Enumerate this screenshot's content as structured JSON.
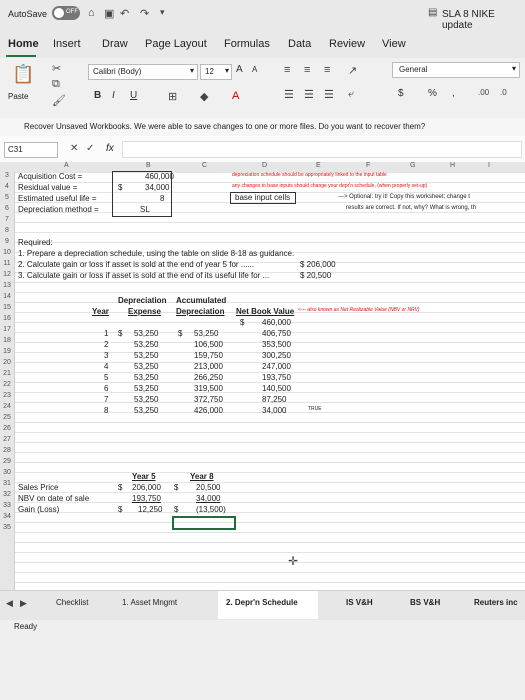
{
  "titlebar": {
    "autosave": "AutoSave",
    "toggle": "OFF",
    "title": "SLA 8 NIKE update"
  },
  "tabs": [
    "Home",
    "Insert",
    "Draw",
    "Page Layout",
    "Formulas",
    "Data",
    "Review",
    "View"
  ],
  "ribbon": {
    "font": "Calibri (Body)",
    "size": "12",
    "grow": "A",
    "shrink": "A",
    "bold": "B",
    "italic": "I",
    "underline": "U",
    "paste": "Paste",
    "numfmt": "General",
    "dollar": "$",
    "percent": "%",
    "comma": ","
  },
  "message": "Recover Unsaved Workbooks.  We were able to save changes to one or more files. Do you want to recover them?",
  "namebox": "C31",
  "fx": "fx",
  "columns": [
    "A",
    "B",
    "C",
    "D",
    "E",
    "F",
    "G",
    "H",
    "I"
  ],
  "rows": [
    "3",
    "4",
    "5",
    "6",
    "7",
    "8",
    "9",
    "10",
    "11",
    "12",
    "13",
    "14",
    "15",
    "16",
    "17",
    "18",
    "19",
    "20",
    "21",
    "22",
    "23",
    "24",
    "25",
    "26",
    "27",
    "28",
    "29",
    "30",
    "31",
    "32",
    "33",
    "34",
    "35"
  ],
  "inputs": {
    "acq_label": "Acquisition Cost =",
    "acq_val": "460,000",
    "res_label": "Residual value =",
    "res_val": "34,000",
    "res_cur": "$",
    "life_label": "Estimated useful life =",
    "life_val": "8",
    "method_label": "Depreciation method =",
    "method_val": "SL"
  },
  "notes": {
    "n1": "depreciation schedule should be appropriately linked to the input table",
    "n2": "any changes to base inputs should change your depr'n schedule, (when properly set-up)",
    "n3": "base input cells",
    "n4": "---> Optional: try it! Copy this worksheet; change t",
    "n5": "results are correct. If not, why? What is wrong, th"
  },
  "required": {
    "head": "Required:",
    "r1": "1. Prepare a depreciation schedule, using the table on slide 8-18 as guidance.",
    "r2": "2. Calculate gain or loss if asset is sold at the end of year 5 for ......",
    "r2v": "$ 206,000",
    "r3": "3. Calculate gain or loss if asset is sold at the end of its useful life for ...",
    "r3v": "$  20,500"
  },
  "schedule": {
    "h_dep": "Depreciation",
    "h_acc": "Accumulated",
    "h_year": "Year",
    "h_exp": "Expense",
    "h_accdep": "Depreciation",
    "h_nbv": "Net Book Value",
    "nbv_note": "<--- also known as Net Realizable Value (NBV or NRV)",
    "nbv0_cur": "$",
    "nbv0": "460,000",
    "rows": [
      {
        "y": "1",
        "e": "53,250",
        "a": "53,250",
        "n": "406,750"
      },
      {
        "y": "2",
        "e": "53,250",
        "a": "106,500",
        "n": "353,500"
      },
      {
        "y": "3",
        "e": "53,250",
        "a": "159,750",
        "n": "300,250"
      },
      {
        "y": "4",
        "e": "53,250",
        "a": "213,000",
        "n": "247,000"
      },
      {
        "y": "5",
        "e": "53,250",
        "a": "266,250",
        "n": "193,750"
      },
      {
        "y": "6",
        "e": "53,250",
        "a": "319,500",
        "n": "140,500"
      },
      {
        "y": "7",
        "e": "53,250",
        "a": "372,750",
        "n": "87,250"
      },
      {
        "y": "8",
        "e": "53,250",
        "a": "426,000",
        "n": "34,000"
      }
    ],
    "true_flag": "TRUE"
  },
  "gain": {
    "h5": "Year 5",
    "h8": "Year 8",
    "sp_label": "Sales Price",
    "sp5": "206,000",
    "sp8": "20,500",
    "nbv_label": "NBV on date of sale",
    "nbv5": "193,750",
    "nbv8": "34,000",
    "gl_label": "Gain (Loss)",
    "gl5": "12,250",
    "gl8": "(13,500)",
    "cur": "$"
  },
  "sheets": [
    "Checklist",
    "1. Asset Mngmt",
    "2. Depr'n Schedule",
    "IS V&H",
    "BS V&H",
    "Reuters inc"
  ],
  "status": "Ready"
}
